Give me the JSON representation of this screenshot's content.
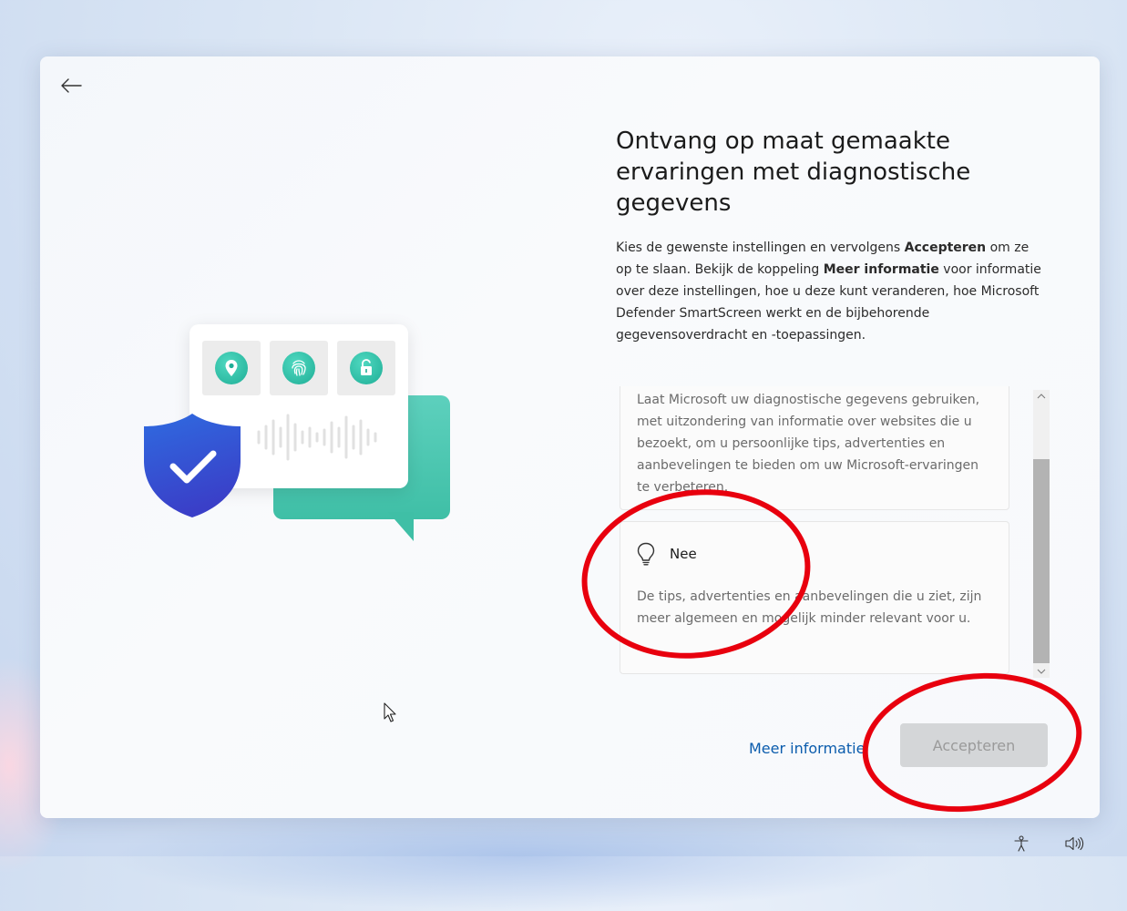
{
  "dialog": {
    "title": "Ontvang op maat gemaakte ervaringen met diagnostische gegevens",
    "description": {
      "part1": "Kies de gewenste instellingen en vervolgens ",
      "accept_bold": "Accepteren",
      "part2": " om ze op te slaan. Bekijk de koppeling ",
      "moreinfo_bold": "Meer informatie",
      "part3": " voor informatie over deze instellingen, hoe u deze kunt veranderen, hoe Microsoft Defender SmartScreen werkt en de bijbehorende gegevensoverdracht en -toepassingen."
    },
    "options": [
      {
        "text": "Laat Microsoft uw diagnostische gegevens gebruiken, met uitzondering van informatie over websites die u bezoekt, om u persoonlijke tips, advertenties en aanbevelingen te bieden om uw Microsoft-ervaringen te verbeteren."
      },
      {
        "label": "Nee",
        "icon": "lightbulb-icon",
        "text": "De tips, advertenties en aanbevelingen die u ziet, zijn meer algemeen en mogelijk minder relevant voor u."
      }
    ],
    "more_info_link": "Meer informatie",
    "accept_button": "Accepteren"
  },
  "colors": {
    "accent_link": "#0b5cad",
    "annotation_red": "#e8000e",
    "illustration_green": "#3fbfa6",
    "shield_blue": "#2a5bd6"
  }
}
